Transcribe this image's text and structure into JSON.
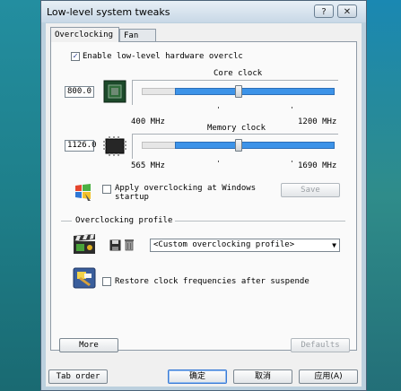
{
  "window": {
    "title": "Low-level system tweaks",
    "help_label": "?",
    "close_label": "✕"
  },
  "tabs": [
    {
      "label": "Overclocking",
      "active": true
    },
    {
      "label": "Fan",
      "active": false
    }
  ],
  "enable_checkbox": {
    "label": "Enable low-level hardware overclc",
    "checked": true
  },
  "core_clock": {
    "title": "Core clock",
    "value": "800.0",
    "min_label": "400 MHz",
    "max_label": "1200 MHz",
    "level": 0.5
  },
  "memory_clock": {
    "title": "Memory clock",
    "value": "1126.0",
    "min_label": "565 MHz",
    "max_label": "1690 MHz",
    "level": 0.5
  },
  "apply_startup": {
    "label_line1": "Apply overclocking at Windows",
    "label_line2": "startup",
    "checked": false
  },
  "save_button": "Save",
  "profile": {
    "section_title": "Overclocking profile",
    "selected": "<Custom overclocking profile>"
  },
  "restore_checkbox": {
    "label": "Restore clock frequencies after suspende",
    "checked": false
  },
  "more_button": "More",
  "defaults_button": "Defaults",
  "bottom": {
    "tab_order": "Tab order",
    "ok": "确定",
    "cancel": "取消",
    "apply": "应用(A)"
  }
}
